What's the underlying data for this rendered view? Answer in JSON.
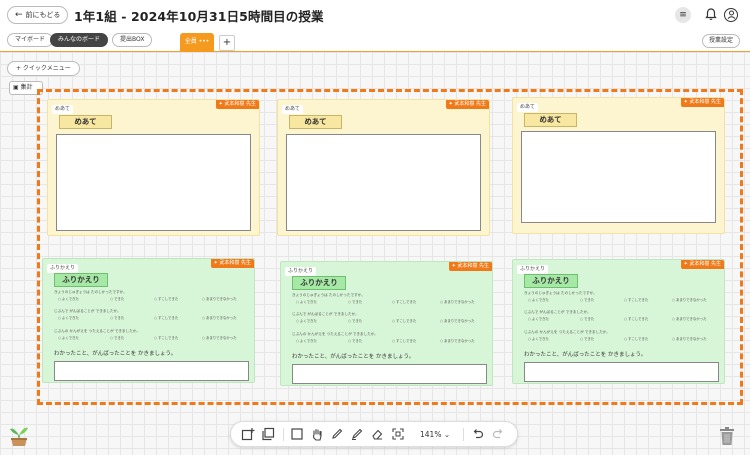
{
  "header": {
    "back_label": "前にもどる",
    "title": "1年1組 - 2024年10月31日5時間目の授業"
  },
  "tabs": {
    "my_board": "マイボード",
    "everyone_board": "みんなのボード",
    "submit_box": "提出BOX",
    "active_tab": "全員 •••",
    "add_tab": "+",
    "settings": "授業設定"
  },
  "sidebar": {
    "quick_menu": "+ クイックメニュー",
    "tally": "集計"
  },
  "cards": {
    "teacher_badge": "武本和樹 先生",
    "goal_tag": "めあて",
    "goal_title": "めあて",
    "review_tag": "ふりかえり",
    "review_title": "ふりかえり",
    "q1": "きょうのじゅぎょうは たのしかったですか。",
    "q2": "じぶんで がんばることが できましたか。",
    "q3": "じぶんの かんがえを つたえることが できましたか。",
    "options": [
      "よくできた",
      "できた",
      "すこしできた",
      "あまりできなかった"
    ],
    "prompt": "わかったこと、がんばったことを かきましょう。"
  },
  "toolbar": {
    "zoom": "141%"
  },
  "colors": {
    "accent": "#f39a1f",
    "selection": "#f07a1a",
    "goal_bg": "#fdf5cf",
    "review_bg": "#d7f5d7"
  }
}
